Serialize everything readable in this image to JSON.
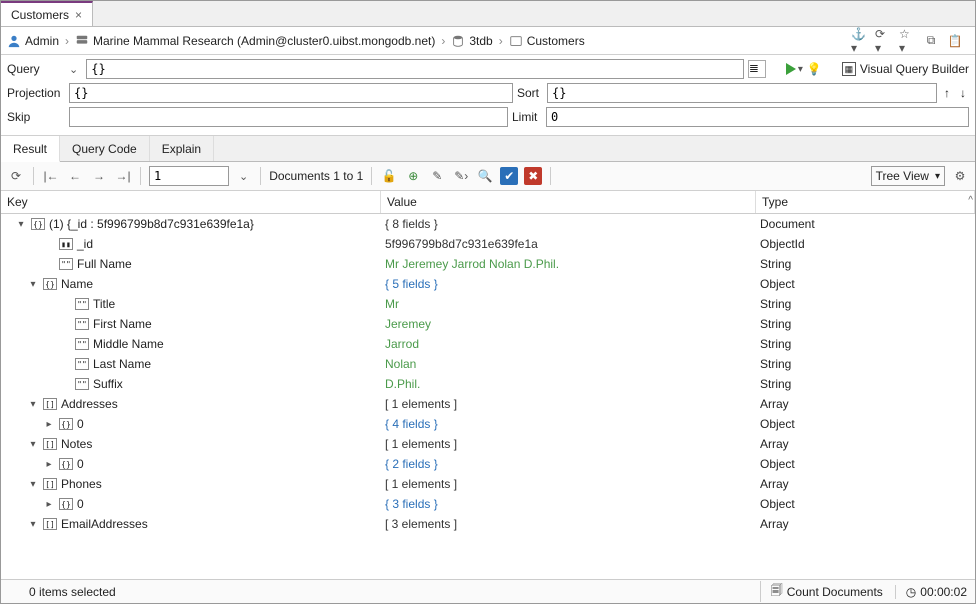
{
  "tab": {
    "title": "Customers"
  },
  "breadcrumb": {
    "user": "Admin",
    "connection": "Marine Mammal Research (Admin@cluster0.uibst.mongodb.net)",
    "db": "3tdb",
    "collection": "Customers"
  },
  "query": {
    "label": "Query",
    "value": "{}",
    "projection_label": "Projection",
    "projection_value": "{}",
    "sort_label": "Sort",
    "sort_value": "{}",
    "skip_label": "Skip",
    "skip_value": "",
    "limit_label": "Limit",
    "limit_value": "0",
    "vqb_label": "Visual Query Builder"
  },
  "result_tabs": {
    "result": "Result",
    "query_code": "Query Code",
    "explain": "Explain"
  },
  "result_toolbar": {
    "page": "1",
    "docs_range": "Documents 1 to 1",
    "view_mode": "Tree View"
  },
  "columns": {
    "key": "Key",
    "value": "Value",
    "type": "Type"
  },
  "document": {
    "root_label": "(1) {_id : 5f996799b8d7c931e639fe1a}",
    "root_value": "{ 8 fields }",
    "root_type": "Document",
    "fields": [
      {
        "k": "_id",
        "v": "5f996799b8d7c931e639fe1a",
        "t": "ObjectId",
        "icon": "id",
        "vclass": "plain",
        "indent": 2
      },
      {
        "k": "Full Name",
        "v": "Mr Jeremey Jarrod Nolan D.Phil.",
        "t": "String",
        "icon": "str",
        "vclass": "str",
        "indent": 2
      },
      {
        "k": "Name",
        "v": "{ 5 fields }",
        "t": "Object",
        "icon": "doc",
        "vclass": "obj",
        "expand": "open",
        "indent": 1
      },
      {
        "k": "Title",
        "v": "Mr",
        "t": "String",
        "icon": "str",
        "vclass": "str",
        "indent": 3
      },
      {
        "k": "First Name",
        "v": "Jeremey",
        "t": "String",
        "icon": "str",
        "vclass": "str",
        "indent": 3
      },
      {
        "k": "Middle Name",
        "v": "Jarrod",
        "t": "String",
        "icon": "str",
        "vclass": "str",
        "indent": 3
      },
      {
        "k": "Last Name",
        "v": "Nolan",
        "t": "String",
        "icon": "str",
        "vclass": "str",
        "indent": 3
      },
      {
        "k": "Suffix",
        "v": "D.Phil.",
        "t": "String",
        "icon": "str",
        "vclass": "str",
        "indent": 3
      },
      {
        "k": "Addresses",
        "v": "[ 1 elements ]",
        "t": "Array",
        "icon": "arr",
        "vclass": "plain",
        "expand": "open",
        "indent": 1
      },
      {
        "k": "0",
        "v": "{ 4 fields }",
        "t": "Object",
        "icon": "doc",
        "vclass": "obj",
        "expand": "closed",
        "indent": 2
      },
      {
        "k": "Notes",
        "v": "[ 1 elements ]",
        "t": "Array",
        "icon": "arr",
        "vclass": "plain",
        "expand": "open",
        "indent": 1
      },
      {
        "k": "0",
        "v": "{ 2 fields }",
        "t": "Object",
        "icon": "doc",
        "vclass": "obj",
        "expand": "closed",
        "indent": 2
      },
      {
        "k": "Phones",
        "v": "[ 1 elements ]",
        "t": "Array",
        "icon": "arr",
        "vclass": "plain",
        "expand": "open",
        "indent": 1
      },
      {
        "k": "0",
        "v": "{ 3 fields }",
        "t": "Object",
        "icon": "doc",
        "vclass": "obj",
        "expand": "closed",
        "indent": 2
      },
      {
        "k": "EmailAddresses",
        "v": "[ 3 elements ]",
        "t": "Array",
        "icon": "arr",
        "vclass": "plain",
        "expand": "open",
        "indent": 1
      }
    ]
  },
  "status": {
    "selected": "0 items selected",
    "count_docs": "Count Documents",
    "elapsed": "00:00:02"
  }
}
